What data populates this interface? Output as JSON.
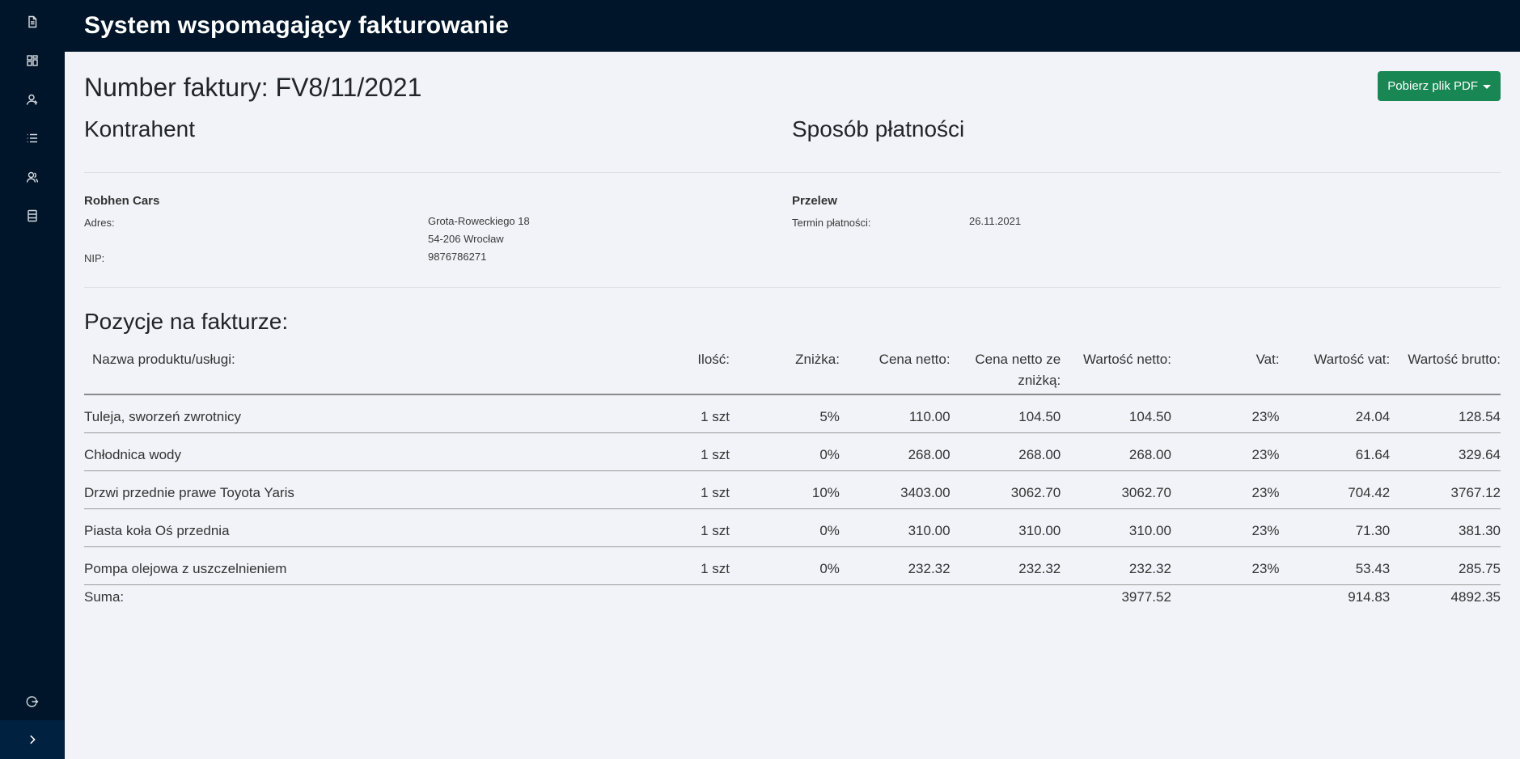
{
  "app": {
    "title": "System wspomagający fakturowanie"
  },
  "sidebar": {
    "icons": [
      "document-icon",
      "dashboard-icon",
      "user-icon",
      "list-icon",
      "users-icon",
      "database-icon"
    ],
    "logout_icon": "logout-icon",
    "toggle_icon": "chevron-right-icon"
  },
  "invoice": {
    "title": "Number faktury: FV8/11/2021",
    "pdf_button": "Pobierz plik PDF"
  },
  "contractor": {
    "heading": "Kontrahent",
    "name": "Robhen Cars",
    "address_label": "Adres:",
    "address_line1": "Grota-Roweckiego 18",
    "address_line2": "54-206 Wrocław",
    "nip_label": "NIP:",
    "nip": "9876786271"
  },
  "payment": {
    "heading": "Sposób płatności",
    "method": "Przelew",
    "due_label": "Termin płatności:",
    "due_date": "26.11.2021"
  },
  "positions": {
    "heading": "Pozycje na fakturze:",
    "columns": [
      "Nazwa produktu/usługi:",
      "Ilość:",
      "Zniżka:",
      "Cena netto:",
      "Cena netto ze zniżką:",
      "Wartość netto:",
      "Vat:",
      "Wartość vat:",
      "Wartość brutto:"
    ],
    "rows": [
      {
        "name": "Tuleja, sworzeń zwrotnicy",
        "qty": "1 szt",
        "discount": "5%",
        "net": "110.00",
        "net_disc": "104.50",
        "net_value": "104.50",
        "vat": "23%",
        "vat_value": "24.04",
        "gross": "128.54"
      },
      {
        "name": "Chłodnica wody",
        "qty": "1 szt",
        "discount": "0%",
        "net": "268.00",
        "net_disc": "268.00",
        "net_value": "268.00",
        "vat": "23%",
        "vat_value": "61.64",
        "gross": "329.64"
      },
      {
        "name": "Drzwi przednie prawe Toyota Yaris",
        "qty": "1 szt",
        "discount": "10%",
        "net": "3403.00",
        "net_disc": "3062.70",
        "net_value": "3062.70",
        "vat": "23%",
        "vat_value": "704.42",
        "gross": "3767.12"
      },
      {
        "name": "Piasta koła Oś przednia",
        "qty": "1 szt",
        "discount": "0%",
        "net": "310.00",
        "net_disc": "310.00",
        "net_value": "310.00",
        "vat": "23%",
        "vat_value": "71.30",
        "gross": "381.30"
      },
      {
        "name": "Pompa olejowa z uszczelnieniem",
        "qty": "1 szt",
        "discount": "0%",
        "net": "232.32",
        "net_disc": "232.32",
        "net_value": "232.32",
        "vat": "23%",
        "vat_value": "53.43",
        "gross": "285.75"
      }
    ],
    "sum": {
      "label": "Suma:",
      "net_value": "3977.52",
      "vat_value": "914.83",
      "gross": "4892.35"
    }
  }
}
